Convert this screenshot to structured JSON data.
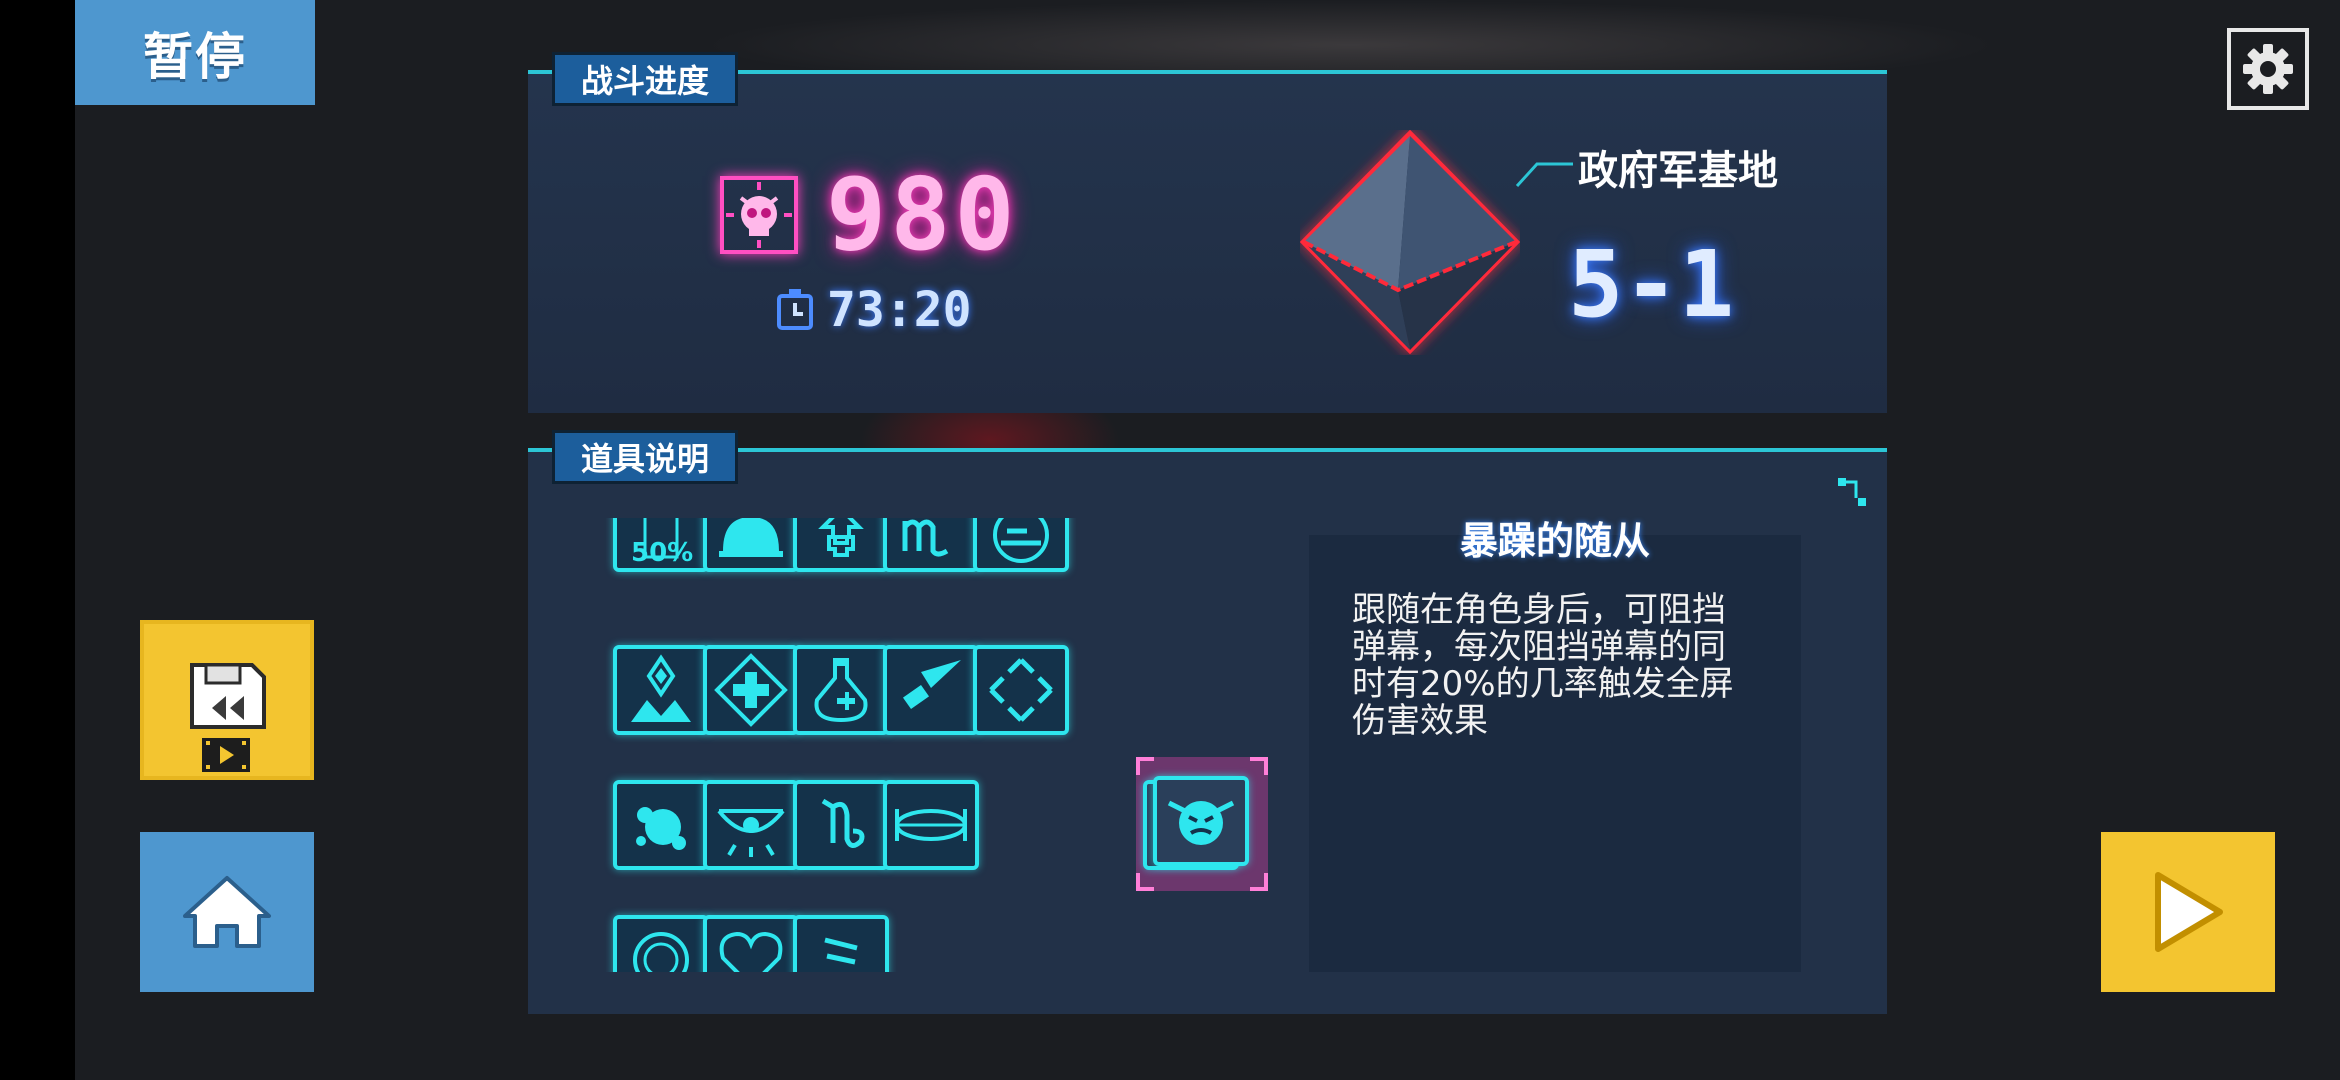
{
  "pause_label": "暂停",
  "progress": {
    "tab_label": "战斗进度",
    "score": "980",
    "time": "73:20",
    "location_name": "政府军基地",
    "level": "5-1"
  },
  "items_panel": {
    "tab_label": "道具说明",
    "items": [
      {
        "name": "half-bottle-item",
        "label": "50%"
      },
      {
        "name": "dome-item"
      },
      {
        "name": "arrow-plus-item"
      },
      {
        "name": "scorpio-sign-item"
      },
      {
        "name": "pizza-item"
      },
      {
        "name": "crystal-sprout-item"
      },
      {
        "name": "medkit-item"
      },
      {
        "name": "potion-item"
      },
      {
        "name": "bullet-item"
      },
      {
        "name": "diamond-target-item"
      },
      {
        "name": "splatter-item"
      },
      {
        "name": "eye-item"
      },
      {
        "name": "capricorn-sign-item"
      },
      {
        "name": "disc-item"
      },
      {
        "name": "angry-minion-item",
        "selected": true
      },
      {
        "name": "badge-item"
      },
      {
        "name": "heart-item"
      },
      {
        "name": "cup-item"
      }
    ],
    "selected_title": "暴躁的随从",
    "description_lines": [
      "跟随在角色身后，可阻挡",
      "弹幕，每次阻挡弹幕的同",
      "时有20%的几率触发全屏",
      "伤害效果"
    ]
  },
  "colors": {
    "neon_cyan": "#2ee6ee",
    "neon_pink": "#ff4fc2",
    "button_yellow": "#f3c530",
    "button_blue": "#4e97cf"
  }
}
